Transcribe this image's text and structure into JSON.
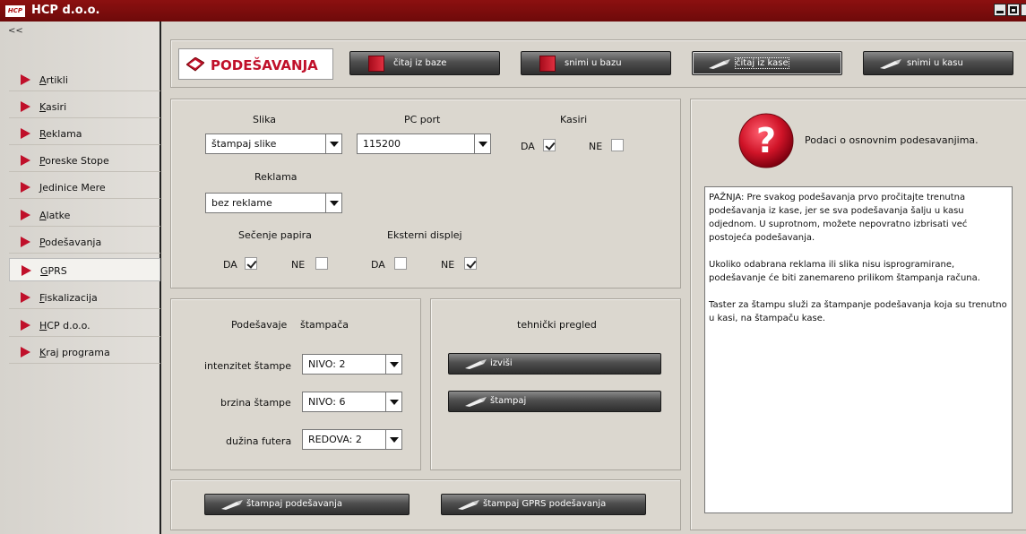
{
  "window": {
    "title": "HCP d.o.o.",
    "logo_text": "HCP"
  },
  "sidebar": {
    "collapse_label": "<<",
    "items": [
      {
        "label": "Artikli"
      },
      {
        "label": "Kasiri"
      },
      {
        "label": "Reklama"
      },
      {
        "label": "Poreske Stope"
      },
      {
        "label": "Jedinice Mere"
      },
      {
        "label": "Alatke"
      },
      {
        "label": "Podešavanja"
      },
      {
        "label": "GPRS"
      },
      {
        "label": "Fiskalizacija"
      },
      {
        "label": "HCP d.o.o."
      },
      {
        "label": "Kraj programa"
      }
    ],
    "active_item": "GPRS"
  },
  "toolbar": {
    "title": "PODEŠAVANJA",
    "buttons": [
      {
        "label": "čitaj iz baze",
        "icon": "book-icon"
      },
      {
        "label": "snimi u bazu",
        "icon": "book-icon"
      },
      {
        "label": "čitaj iz kase",
        "icon": "pen-icon"
      },
      {
        "label": "snimi u kasu",
        "icon": "pen-icon"
      }
    ]
  },
  "settings": {
    "slika_label": "Slika",
    "slika_value": "štampaj slike",
    "pcport_label": "PC port",
    "pcport_value": "115200",
    "kasiri_label": "Kasiri",
    "kasiri_da_label": "DA",
    "kasiri_ne_label": "NE",
    "kasiri_da_checked": true,
    "kasiri_ne_checked": false,
    "reklama_label": "Reklama",
    "reklama_value": "bez reklame",
    "secenje_label": "Sečenje papira",
    "secenje_da_label": "DA",
    "secenje_ne_label": "NE",
    "secenje_da_checked": true,
    "secenje_ne_checked": false,
    "displej_label": "Eksterni displej",
    "displej_da_label": "DA",
    "displej_ne_label": "NE",
    "displej_da_checked": false,
    "displej_ne_checked": true
  },
  "printer": {
    "heading_1": "Podešavaje",
    "heading_2": "štampača",
    "intenzitet_label": "intenzitet štampe",
    "intenzitet_value": "NIVO: 2",
    "brzina_label": "brzina štampe",
    "brzina_value": "NIVO: 6",
    "duzina_label": "dužina futera",
    "duzina_value": "REDOVA: 2"
  },
  "tech": {
    "heading": "tehnički pregled",
    "izvisi_label": "izviši",
    "stampaj_label": "štampaj"
  },
  "bottom": {
    "print_settings_label": "štampaj podešavanja",
    "print_gprs_label": "štampaj GPRS podešavanja"
  },
  "info": {
    "header": "Podaci o osnovnim podesavanjima.",
    "notes": "PAŽNJA: Pre svakog podešavanja prvo pročitajte trenutna podešavanja iz kase, jer se sva podešavanja šalju u kasu odjednom. U suprotnom, možete nepovratno izbrisati već postojeća podešavanja.\n\nUkoliko odabrana reklama ili slika nisu isprogramirane, podešavanje će biti zanemareno prilikom štampanja računa.\n\nTaster za štampu služi za štampanje podešavanja koja su trenutno u kasi, na štampaču kase."
  },
  "colors": {
    "accent": "#c0102a",
    "titlebar": "#7a0c0c"
  }
}
